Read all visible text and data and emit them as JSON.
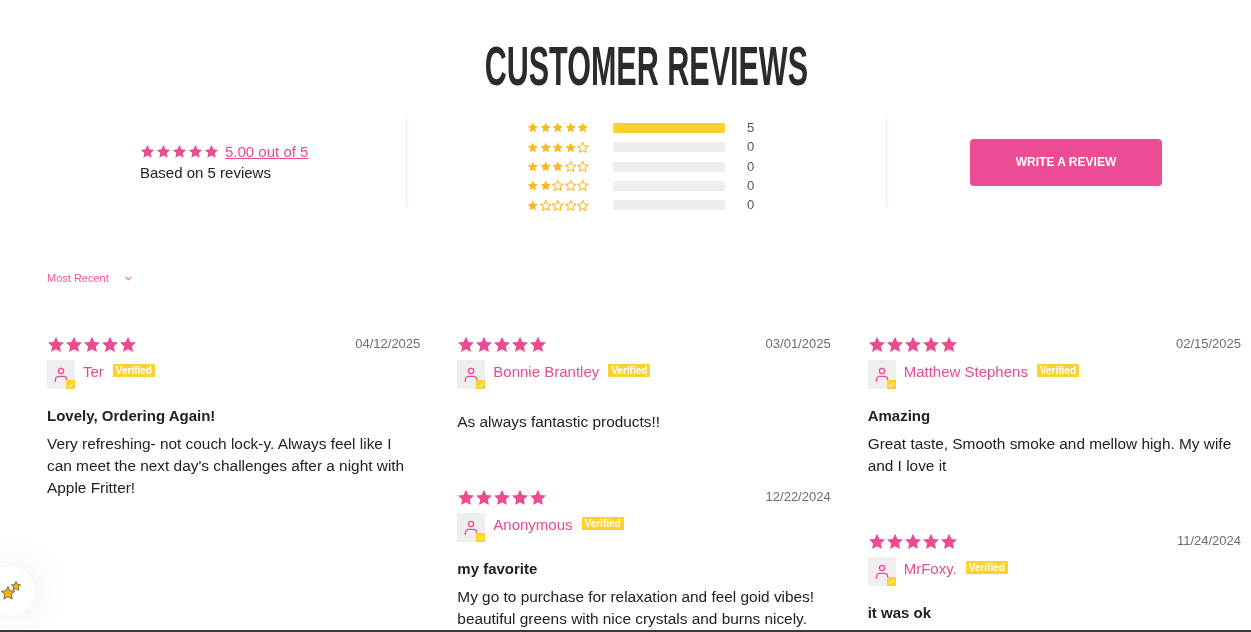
{
  "title": "CUSTOMER REVIEWS",
  "summary": {
    "stars": 5,
    "average_link": "5.00 out of 5",
    "based_on": "Based on 5 reviews"
  },
  "histogram": [
    {
      "stars": 5,
      "level": 1,
      "count": "5"
    },
    {
      "stars": 4,
      "level": 0,
      "count": "0"
    },
    {
      "stars": 3,
      "level": 0,
      "count": "0"
    },
    {
      "stars": 2,
      "level": 0,
      "count": "0"
    },
    {
      "stars": 1,
      "level": 0,
      "count": "0"
    }
  ],
  "write_review_button": "WRITE A REVIEW",
  "sort": {
    "value": "Most Recent"
  },
  "review_columns": [
    {
      "reviews": [
        {
          "stars": 5,
          "date": "04/12/2025",
          "name": "Ter",
          "verified": true,
          "badge": "Verified",
          "title": "Lovely, Ordering Again!",
          "body": "Very refreshing- not couch lock-y. Always feel like I can meet the next day's challenges after a night with Apple Fritter!"
        }
      ]
    },
    {
      "reviews": [
        {
          "stars": 5,
          "date": "03/01/2025",
          "name": "Bonnie Brantley",
          "verified": true,
          "badge": "Verified",
          "body": "As always fantastic products!!"
        },
        {
          "stars": 5,
          "date": "12/22/2024",
          "name": "Anonymous",
          "verified": true,
          "badge": "Verified",
          "title": "my favorite",
          "body": "My go to purchase for relaxation and feel goid vibes! beautiful greens with nice crystals and burns nicely."
        }
      ]
    },
    {
      "reviews": [
        {
          "stars": 5,
          "date": "02/15/2025",
          "name": "Matthew Stephens",
          "verified": true,
          "badge": "Verified",
          "title": "Amazing",
          "body": "Great taste, Smooth smoke and mellow high. My wife and I love it"
        },
        {
          "stars": 5,
          "date": "11/24/2024",
          "name": "MrFoxy.",
          "verified": true,
          "badge": "Verified",
          "title": "it was ok"
        }
      ]
    }
  ]
}
